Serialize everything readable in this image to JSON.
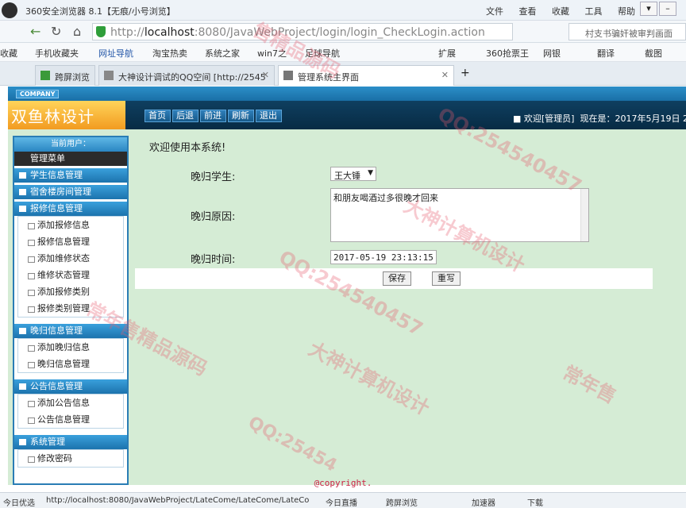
{
  "browser": {
    "title": "360安全浏览器 8.1【无痕/小号浏览】",
    "menus": [
      "文件",
      "查看",
      "收藏",
      "工具",
      "帮助"
    ],
    "url_prefix": "http://",
    "url_host": "localhost",
    "url_rest": ":8080/JavaWebProject/login/login_CheckLogin.action",
    "search_text": "村支书骗奸被审判画面",
    "bookmarks": [
      "收藏",
      "手机收藏夹",
      "网址导航",
      "淘宝热卖",
      "系统之家",
      "win7之",
      "足球导航",
      "扩展",
      "360抢票王",
      "网银",
      "翻译",
      "截图"
    ],
    "tabs": [
      "跨屏浏览",
      "大神设计调试的QQ空间 [http://2545",
      "管理系统主界面"
    ],
    "new_tab": "+"
  },
  "app": {
    "company": "COMPANY",
    "brand": "双鱼林设计",
    "toolbar": [
      "首页",
      "后退",
      "前进",
      "刷新",
      "退出"
    ],
    "welcome": "欢迎[管理员]",
    "now_label": "现在是：2017年5月19日 2"
  },
  "sidebar": {
    "user_label": "当前用户：",
    "menu_title": "管理菜单",
    "groups": [
      {
        "title": "学生信息管理",
        "items": []
      },
      {
        "title": "宿舍楼房间管理",
        "items": []
      },
      {
        "title": "报修信息管理",
        "items": [
          "添加报修信息",
          "报修信息管理",
          "添加维修状态",
          "维修状态管理",
          "添加报修类别",
          "报修类别管理"
        ]
      },
      {
        "title": "晚归信息管理",
        "items": [
          "添加晚归信息",
          "晚归信息管理"
        ]
      },
      {
        "title": "公告信息管理",
        "items": [
          "添加公告信息",
          "公告信息管理"
        ]
      },
      {
        "title": "系统管理",
        "items": [
          "修改密码"
        ]
      }
    ]
  },
  "main": {
    "title": "欢迎使用本系统!",
    "student_label": "晚归学生:",
    "student_value": "王大锤",
    "reason_label": "晚归原因:",
    "reason_value": "和朋友喝酒过多很晚才回来",
    "time_label": "晚归时间:",
    "time_value": "2017-05-19 23:13:15",
    "save_label": "保存",
    "reset_label": "重写"
  },
  "footer": {
    "copyright": "@copyright."
  },
  "statusbar": {
    "left": "今日优选",
    "url": "http://localhost:8080/JavaWebProject/LateCome/LateCome/LateCo",
    "items": [
      "今日直播",
      "跨屏浏览",
      "加速器",
      "下载"
    ]
  },
  "watermarks": [
    "售精品源码",
    "QQ:254540457",
    "大神计算机设计",
    "常年售精品源码",
    "QQ:254540457",
    "大神计算机设计",
    "常年售",
    "QQ:25454"
  ]
}
